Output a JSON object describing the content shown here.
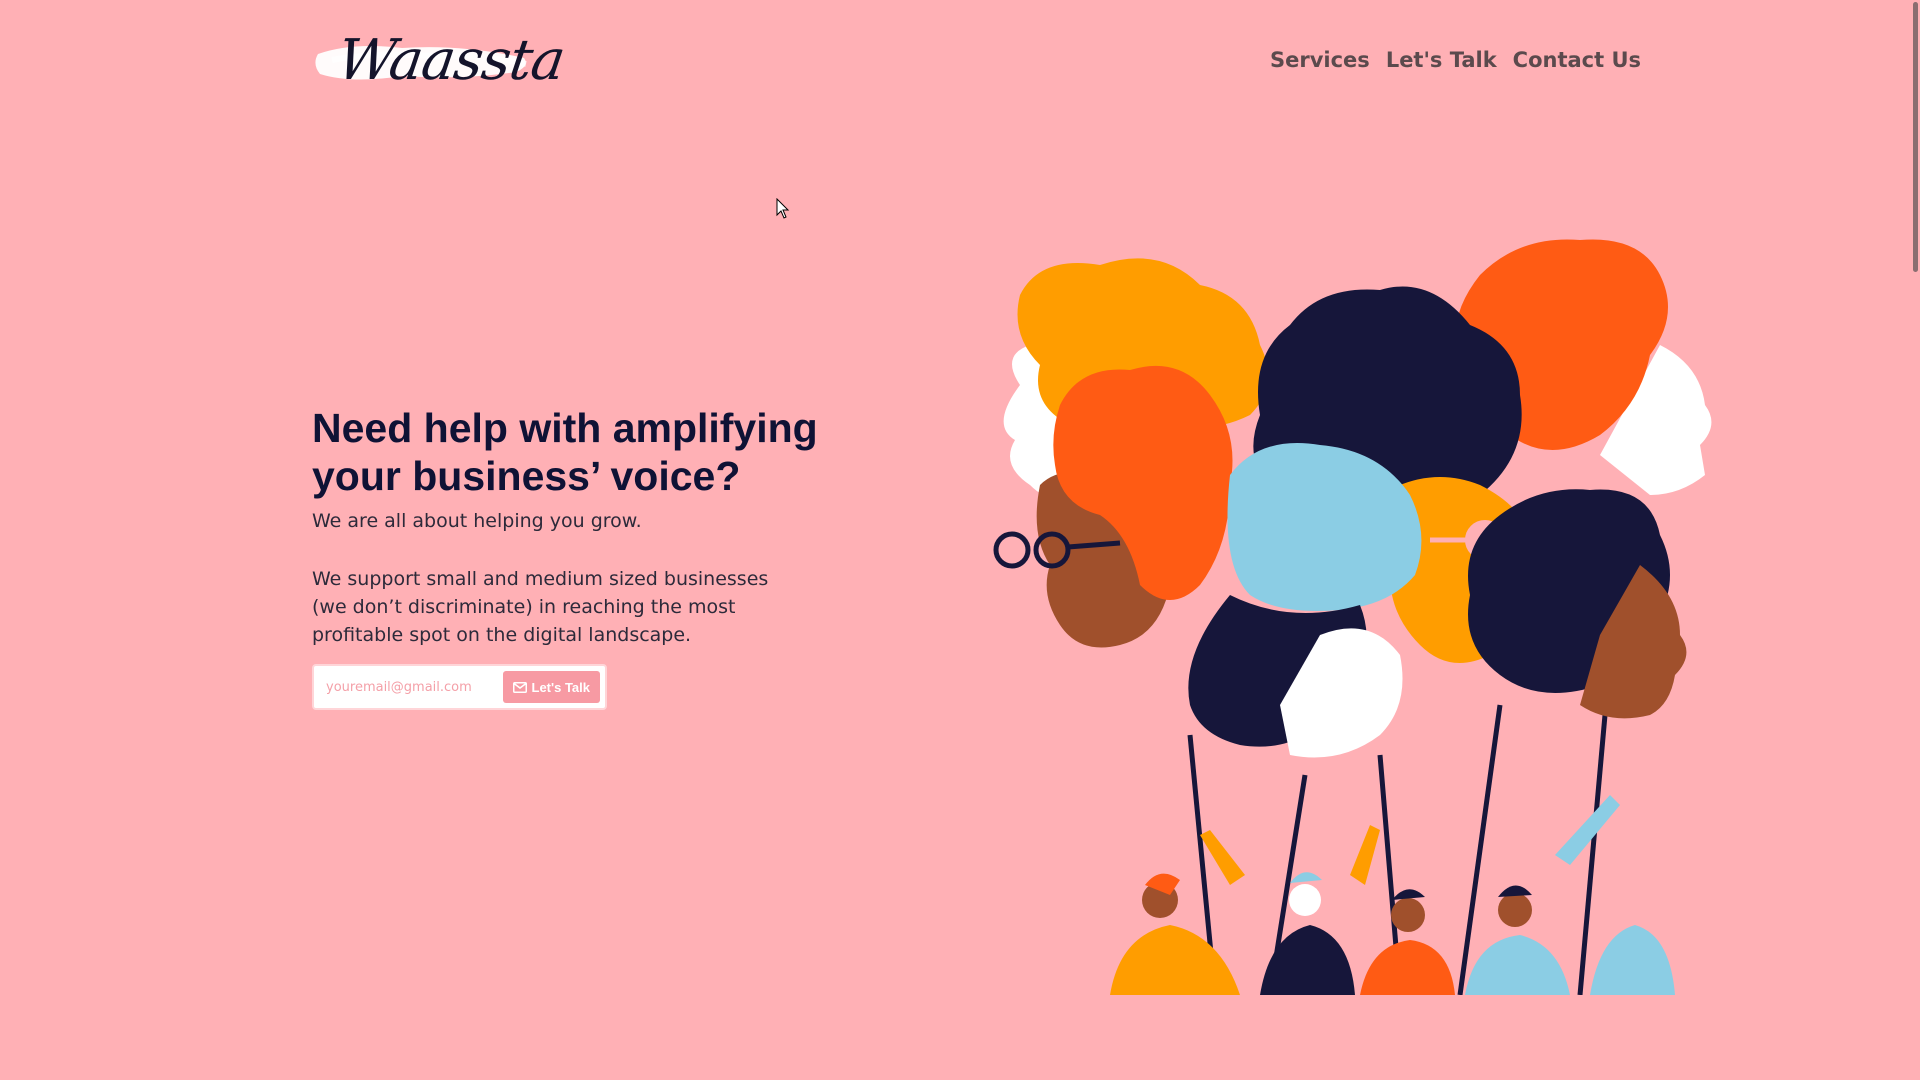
{
  "header": {
    "logo_text": "Waassta",
    "nav": [
      {
        "label": "Services"
      },
      {
        "label": "Let's Talk"
      },
      {
        "label": "Contact Us"
      }
    ]
  },
  "hero": {
    "title": "Need help with amplifying your business’ voice?",
    "subtitle": "We are all about helping you grow.",
    "body": "We support small and medium sized businesses (we don’t discriminate) in reaching the most profitable spot on the digital landscape.",
    "email_placeholder": "youremail@gmail.com",
    "email_value": "",
    "cta_label": "Let's Talk",
    "cta_icon": "mail-icon"
  },
  "illustration": {
    "icon": "diverse-heads-illustration"
  },
  "colors": {
    "background": "#ffb0b5",
    "title": "#0f1235",
    "button": "#f79aa3",
    "orange": "#ff9d00",
    "red_orange": "#ff5b14",
    "navy": "#16163a",
    "light_blue": "#8bcde4",
    "brown": "#a0502c"
  }
}
